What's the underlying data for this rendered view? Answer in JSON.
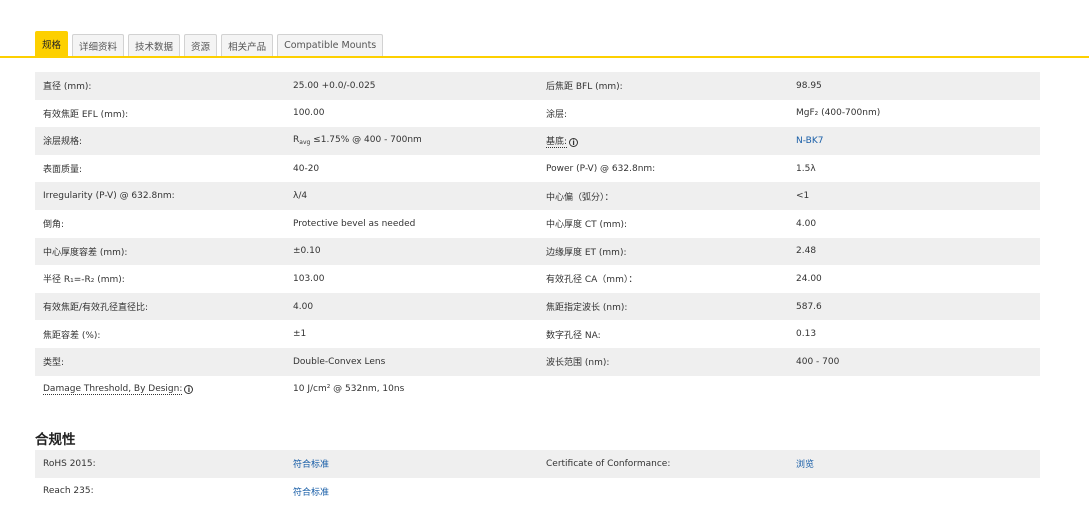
{
  "tabs": [
    "规格",
    "详细资料",
    "技术数据",
    "资源",
    "相关产品",
    "Compatible Mounts"
  ],
  "colors": {
    "accent": "#fdd000",
    "link": "#1a5fa8",
    "row_shade": "#efefef"
  },
  "icons": {
    "info": "info-circle-icon"
  },
  "specs": [
    {
      "l1": "直径 (mm):",
      "v1": "25.00 +0.0/-0.025",
      "l2": "后焦距 BFL (mm):",
      "v2": "98.95"
    },
    {
      "l1": "有效焦距 EFL (mm):",
      "v1": "100.00",
      "l2": "涂层:",
      "v2": "MgF₂ (400-700nm)"
    },
    {
      "l1": "涂层规格:",
      "v1_main": "R",
      "v1_sub": "avg",
      "v1_rest": " ≤1.75% @ 400 - 700nm",
      "l2": "基底:",
      "v2": "N-BK7"
    },
    {
      "l1": "表面质量:",
      "v1": "40-20",
      "l2": "Power (P-V) @ 632.8nm:",
      "v2": "1.5λ"
    },
    {
      "l1": "Irregularity (P-V) @ 632.8nm:",
      "v1": "λ/4",
      "l2": "中心偏（弧分）：",
      "v2": "<1"
    },
    {
      "l1": "倒角:",
      "v1": "Protective bevel as needed",
      "l2": "中心厚度 CT (mm):",
      "v2": "4.00"
    },
    {
      "l1": "中心厚度容差 (mm):",
      "v1": "±0.10",
      "l2": "边缘厚度 ET (mm):",
      "v2": "2.48"
    },
    {
      "l1": "半径 R₁=-R₂ (mm):",
      "v1": "103.00",
      "l2": "有效孔径 CA（mm）：",
      "v2": "24.00"
    },
    {
      "l1": "有效焦距/有效孔径直径比:",
      "v1": "4.00",
      "l2": "焦距指定波长 (nm):",
      "v2": "587.6"
    },
    {
      "l1": "焦距容差 (%):",
      "v1": "±1",
      "l2": "数字孔径 NA:",
      "v2": "0.13"
    },
    {
      "l1": "类型:",
      "v1": "Double-Convex Lens",
      "l2": "波长范围 (nm):",
      "v2": "400 - 700"
    },
    {
      "l1": "Damage Threshold, By Design:",
      "v1": "10 J/cm² @ 532nm, 10ns",
      "l2": "",
      "v2": ""
    }
  ],
  "compliance_title": "合规性",
  "compliance": [
    {
      "l1": "RoHS 2015:",
      "v1": "符合标准",
      "l2": "Certificate of Conformance:",
      "v2": "浏览"
    },
    {
      "l1": "Reach 235:",
      "v1": "符合标准",
      "l2": "",
      "v2": ""
    }
  ]
}
